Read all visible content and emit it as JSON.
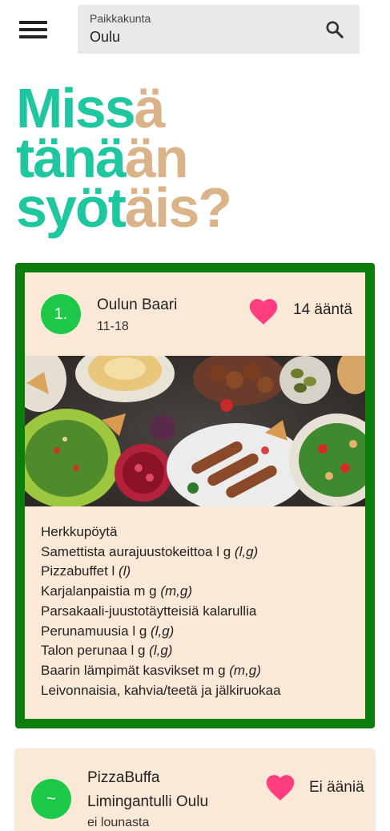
{
  "header": {
    "menu_icon": "hamburger-menu-icon",
    "search": {
      "label": "Paikkakunta",
      "value": "Oulu",
      "icon": "search-icon"
    }
  },
  "headline": {
    "line1_a": "Miss",
    "line1_b": "ä",
    "line2_a": "tänä",
    "line2_b": "än",
    "line3_a": "syöt",
    "line3_b": "äis?",
    "colors": {
      "primary": "#1fc7a0",
      "secondary": "#dbb389"
    }
  },
  "restaurants": [
    {
      "rank": "1.",
      "name": "Oulun Baari",
      "hours": "11-18",
      "votes": "14 ääntä",
      "heart_icon": "heart-icon",
      "image": "food-platter-image",
      "menu": [
        {
          "dish": "Herkkupöytä",
          "diet": ""
        },
        {
          "dish": "Samettista aurajuustokeittoa l g ",
          "diet": "(l,g)"
        },
        {
          "dish": "Pizzabuffet l ",
          "diet": "(l)"
        },
        {
          "dish": "Karjalanpaistia m g ",
          "diet": "(m,g)"
        },
        {
          "dish": "Parsakaali-juustotäytteisiä kalarullia",
          "diet": ""
        },
        {
          "dish": "Perunamuusia l g ",
          "diet": "(l,g)"
        },
        {
          "dish": "Talon perunaa l g ",
          "diet": "(l,g)"
        },
        {
          "dish": "Baarin lämpimät kasvikset m g ",
          "diet": "(m,g)"
        },
        {
          "dish": "Leivonnaisia, kahvia/teetä ja jälkiruokaa",
          "diet": ""
        }
      ],
      "colors": {
        "frame": "#0b7e0b",
        "card_bg": "#fbe9d8",
        "badge": "#1ec94a",
        "heart": "#ff3d7f"
      }
    },
    {
      "rank": "~",
      "name": "PizzaBuffa",
      "location": "Limingantulli Oulu",
      "hours": "ei lounasta",
      "votes": "Ei ääniä",
      "heart_icon": "heart-icon"
    }
  ]
}
